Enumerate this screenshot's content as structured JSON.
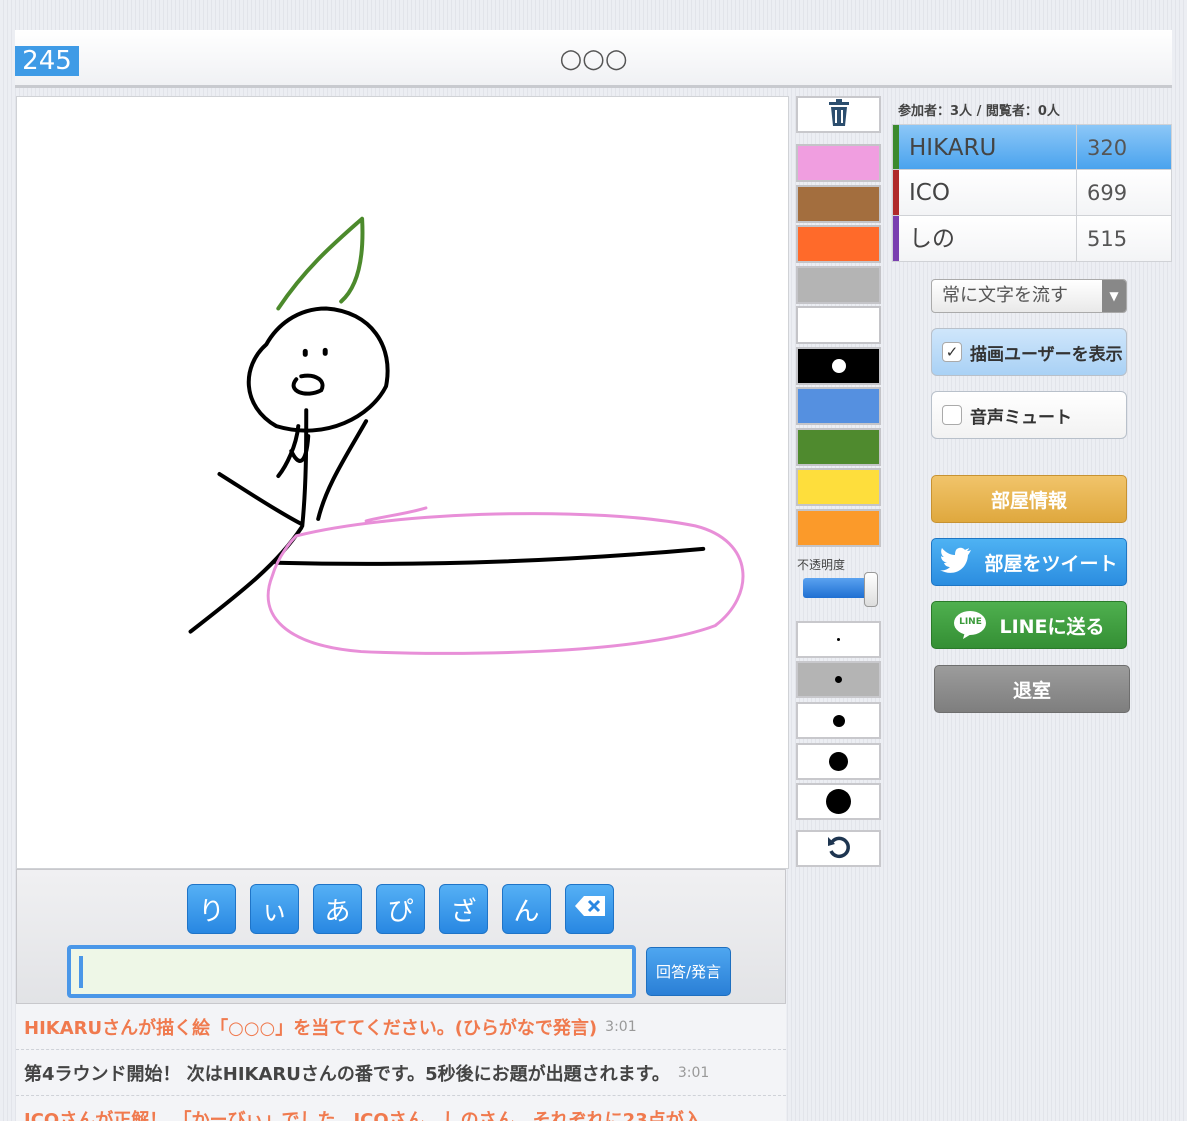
{
  "timer": "245",
  "topic": "○○○",
  "participants": "参加者：3人 / 閲覧者：0人",
  "players": [
    {
      "name": "HIKARU",
      "score": "320",
      "color": "#3c8a2e",
      "active": true
    },
    {
      "name": "ICO",
      "score": "699",
      "color": "#b02a2a",
      "active": false
    },
    {
      "name": "しの",
      "score": "515",
      "color": "#7a3fb0",
      "active": false
    }
  ],
  "palette": [
    "#f09ee0",
    "#a36e3e",
    "#ff6a2a",
    "#b4b4b4",
    "#ffffff",
    "#000000",
    "#5590e0",
    "#4f8a2e",
    "#fede3c",
    "#fb9a2a"
  ],
  "opacity_label": "不透明度",
  "opacity_value": 0.9,
  "scroll_select": "常に文字を流す",
  "show_drawer": {
    "label": "描画ユーザーを表示",
    "checked": true
  },
  "mute": {
    "label": "音声ミュート",
    "checked": false
  },
  "room_info": "部屋情報",
  "tweet": "部屋をツイート",
  "line": "LINEに送る",
  "line_logo": "LINE",
  "leave": "退室",
  "kana_keys": [
    "り",
    "ぃ",
    "あ",
    "ぴ",
    "ざ",
    "ん"
  ],
  "answer_value": "",
  "submit": "回答/発言",
  "chat": [
    {
      "text": "HIKARUさんが描く絵「○○○」を当ててください。(ひらがなで発言)",
      "time": "3:01",
      "color": "#f07a4e"
    },
    {
      "text": "第4ラウンド開始！ 次はHIKARUさんの番です。5秒後にお題が出題されます。",
      "time": "3:01",
      "color": "#444444"
    },
    {
      "text": "ICOさんが正解！ 「かーびぃ」でした。ICOさん、しのさん、それぞれに23点が入",
      "time": "",
      "color": "#f07a4e"
    }
  ]
}
